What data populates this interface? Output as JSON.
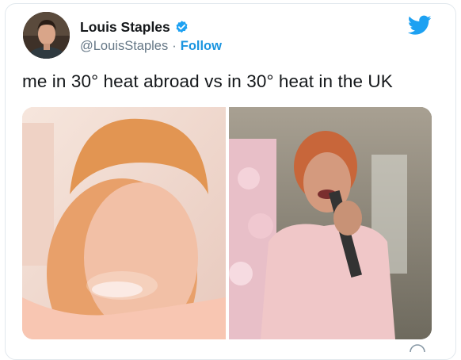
{
  "author": {
    "name": "Louis Staples",
    "handle": "@LouisStaples",
    "separator": "·",
    "follow_label": "Follow"
  },
  "icons": {
    "verified": "verified-badge-icon",
    "logo": "twitter-bird-icon"
  },
  "tweet": {
    "text": "me in 30° heat abroad  vs  in 30° heat in the UK"
  },
  "colors": {
    "brand": "#1da1f2",
    "link": "#1b95e0",
    "text": "#14171a",
    "muted": "#657786"
  }
}
